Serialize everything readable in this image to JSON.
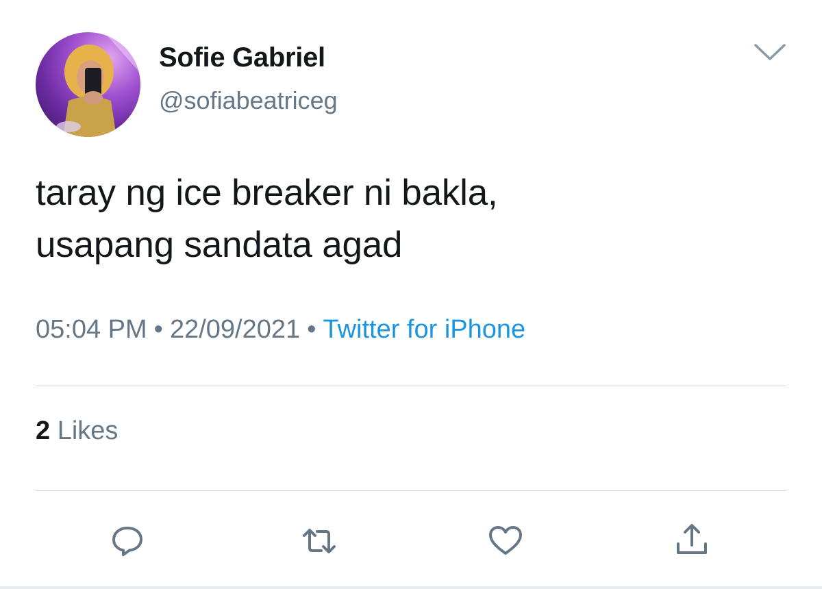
{
  "user": {
    "display_name": "Sofie Gabriel",
    "handle": "@sofiabeatriceg",
    "avatar_icon": "profile-photo"
  },
  "tweet": {
    "text_lines": [
      "taray ng ice breaker ni bakla,",
      "usapang sandata agad"
    ],
    "time": "05:04 PM",
    "date": "22/09/2021",
    "separator": "•",
    "source": "Twitter for iPhone"
  },
  "stats": {
    "likes_count": "2",
    "likes_label": "Likes"
  },
  "actions": [
    {
      "icon": "reply-icon"
    },
    {
      "icon": "retweet-icon"
    },
    {
      "icon": "like-icon"
    },
    {
      "icon": "share-icon"
    }
  ],
  "colors": {
    "text_primary": "#14171a",
    "text_secondary": "#657786",
    "link": "#1b95e0",
    "icon": "#657786",
    "divider": "#cfd5da"
  }
}
